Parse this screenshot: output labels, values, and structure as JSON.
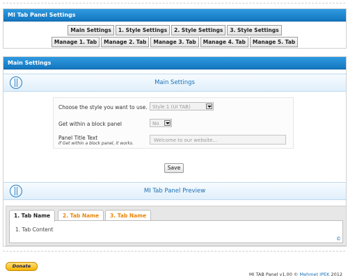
{
  "settings_panel": {
    "header": "MI Tab Panel Settings",
    "row1": [
      "Main Settings",
      "1. Style Settings",
      "2. Style Settings",
      "3. Style Settings"
    ],
    "row2": [
      "Manage 1. Tab",
      "Manage 2. Tab",
      "Manage 3. Tab",
      "Manage 4. Tab",
      "Manage 5. Tab"
    ]
  },
  "main_panel": {
    "header": "Main Settings",
    "section_title": "Main Settings",
    "style_label": "Choose the style you want to use.",
    "style_value": "Style 1 (UI TAB)",
    "block_label": "Get within a block panel",
    "block_value": "No",
    "title_label": "Panel Title Text",
    "title_hint": "If Get within a block panel, it works.",
    "title_placeholder": "Welcome to our website...",
    "save_label": "Save",
    "preview_title": "MI Tab Panel Preview",
    "preview_tabs": [
      "1. Tab Name",
      "2. Tab Name",
      "3. Tab Name"
    ],
    "preview_content": "1. Tab Content",
    "copyright_mark": "©"
  },
  "footer": {
    "donate_label": "Donate",
    "version_text": "MI TAB Panel v1.00 ©",
    "author": "Mehmet IPEK",
    "year": "2012"
  },
  "colors": {
    "header_blue": "#1f86cf",
    "tab_orange": "#e8870c",
    "title_blue": "#1a6fb5"
  }
}
